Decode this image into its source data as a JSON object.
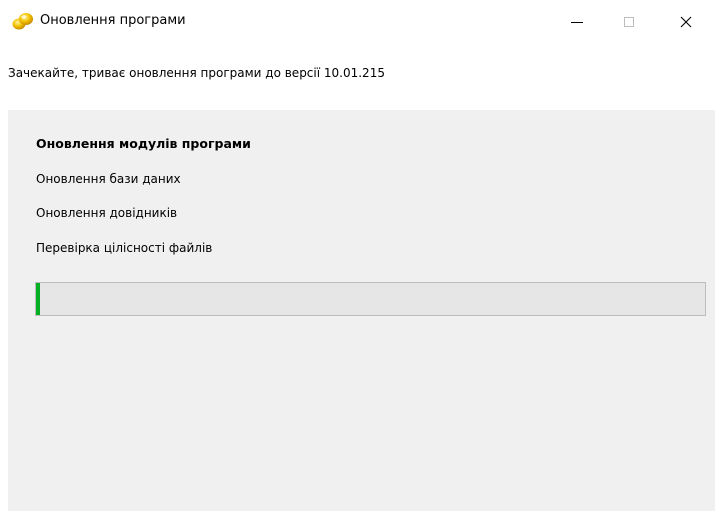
{
  "window": {
    "title": "Оновлення програми",
    "icon": "coins-icon"
  },
  "subtitle": "Зачекайте, триває оновлення програми до версії 10.01.215",
  "steps": [
    {
      "label": "Оновлення модулів програми",
      "active": true
    },
    {
      "label": "Оновлення бази даних",
      "active": false
    },
    {
      "label": "Оновлення довідників",
      "active": false
    },
    {
      "label": "Перевірка цілісності файлів",
      "active": false
    }
  ],
  "progress": {
    "percent": 0.6,
    "color": "#06b025"
  },
  "colors": {
    "panel": "#f0f0f0",
    "progress_track": "#e6e6e6",
    "icon_gold": "#f2c200"
  }
}
